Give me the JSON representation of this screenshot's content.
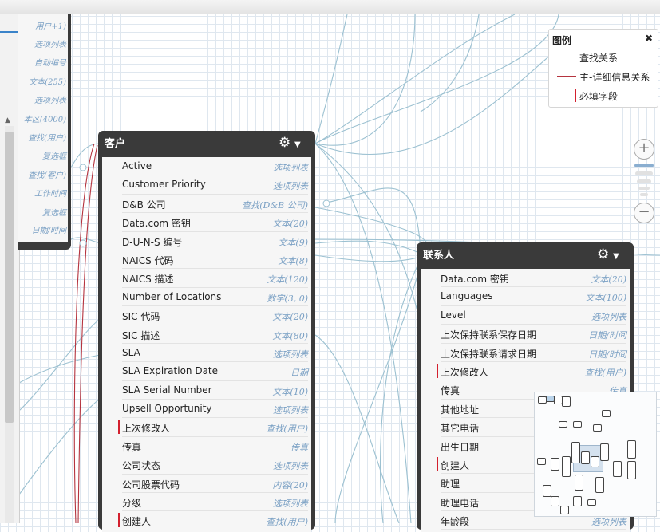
{
  "left_panel_types": [
    "用户+1)",
    "选项列表",
    "自动编号",
    "文本(255)",
    "选项列表",
    "本区(4000)",
    "查找(用户)",
    "复选框",
    "查找(客户)",
    "工作时间",
    "复选框",
    "日期/时间"
  ],
  "account": {
    "title": "客户",
    "fields": [
      {
        "name": "Active",
        "type": "选项列表",
        "required": false
      },
      {
        "name": "Customer Priority",
        "type": "选项列表",
        "required": false
      },
      {
        "name": "D&B 公司",
        "type": "查找(D&B 公司)",
        "required": false
      },
      {
        "name": "Data.com 密钥",
        "type": "文本(20)",
        "required": false
      },
      {
        "name": "D-U-N-S 编号",
        "type": "文本(9)",
        "required": false
      },
      {
        "name": "NAICS 代码",
        "type": "文本(8)",
        "required": false
      },
      {
        "name": "NAICS 描述",
        "type": "文本(120)",
        "required": false
      },
      {
        "name": "Number of Locations",
        "type": "数字(3, 0)",
        "required": false
      },
      {
        "name": "SIC 代码",
        "type": "文本(20)",
        "required": false
      },
      {
        "name": "SIC 描述",
        "type": "文本(80)",
        "required": false
      },
      {
        "name": "SLA",
        "type": "选项列表",
        "required": false
      },
      {
        "name": "SLA Expiration Date",
        "type": "日期",
        "required": false
      },
      {
        "name": "SLA Serial Number",
        "type": "文本(10)",
        "required": false
      },
      {
        "name": "Upsell Opportunity",
        "type": "选项列表",
        "required": false
      },
      {
        "name": "上次修改人",
        "type": "查找(用户)",
        "required": true
      },
      {
        "name": "传真",
        "type": "传真",
        "required": false
      },
      {
        "name": "公司状态",
        "type": "选项列表",
        "required": false
      },
      {
        "name": "公司股票代码",
        "type": "内容(20)",
        "required": false
      },
      {
        "name": "分级",
        "type": "选项列表",
        "required": false
      },
      {
        "name": "创建人",
        "type": "查找(用户)",
        "required": true
      }
    ]
  },
  "contact": {
    "title": "联系人",
    "fields": [
      {
        "name": "Data.com 密钥",
        "type": "文本(20)",
        "required": false
      },
      {
        "name": "Languages",
        "type": "文本(100)",
        "required": false
      },
      {
        "name": "Level",
        "type": "选项列表",
        "required": false
      },
      {
        "name": "上次保持联系保存日期",
        "type": "日期/时间",
        "required": false
      },
      {
        "name": "上次保持联系请求日期",
        "type": "日期/时间",
        "required": false
      },
      {
        "name": "上次修改人",
        "type": "查找(用户)",
        "required": true
      },
      {
        "name": "传真",
        "type": "传真",
        "required": false
      },
      {
        "name": "其他地址",
        "type": "",
        "required": false
      },
      {
        "name": "其它电话",
        "type": "",
        "required": false
      },
      {
        "name": "出生日期",
        "type": "",
        "required": false
      },
      {
        "name": "创建人",
        "type": "",
        "required": true
      },
      {
        "name": "助理",
        "type": "",
        "required": false
      },
      {
        "name": "助理电话",
        "type": "",
        "required": false
      },
      {
        "name": "年龄段",
        "type": "选项列表",
        "required": false
      }
    ]
  },
  "legend": {
    "title": "图例",
    "close": "✖",
    "lookup_label": "查找关系",
    "master_detail_label": "主-详细信息关系",
    "required_label": "必填字段",
    "lookup_color": "#8fb7c8",
    "master_detail_color": "#b5343f",
    "required_color": "#d3202e"
  },
  "zoom": {
    "in": "+",
    "out": "−",
    "level": 1,
    "levels": 5
  },
  "icons": {
    "gear": "gear-icon",
    "chevron": "chevron-down-icon",
    "close": "close-icon",
    "left_arrow": "triangle-left-icon",
    "scroll_up": "triangle-up-icon"
  }
}
